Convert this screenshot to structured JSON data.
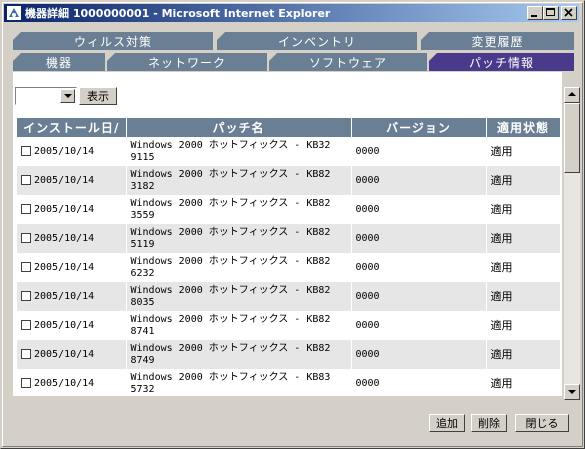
{
  "window": {
    "title": "機器詳細 1000000001 - Microsoft Internet Explorer",
    "icon": "ie-window-icon"
  },
  "tabs_top": [
    {
      "label": "ウィルス対策"
    },
    {
      "label": "インベントリ"
    },
    {
      "label": "変更履歴"
    }
  ],
  "tabs_bottom": [
    {
      "label": "機器"
    },
    {
      "label": "ネットワーク"
    },
    {
      "label": "ソフトウェア"
    },
    {
      "label": "パッチ情報",
      "active": true
    }
  ],
  "filter": {
    "selected": "",
    "show_label": "表示"
  },
  "table": {
    "columns": [
      "インストール日",
      "パッチ名",
      "バージョン",
      "適用状態"
    ],
    "sort_indicator": "/",
    "rows": [
      {
        "date": "2005/10/14",
        "name1": "Windows 2000 ホットフィックス - KB32",
        "name2": "9115",
        "version": "0000",
        "state": "適用"
      },
      {
        "date": "2005/10/14",
        "name1": "Windows 2000 ホットフィックス - KB82",
        "name2": "3182",
        "version": "0000",
        "state": "適用"
      },
      {
        "date": "2005/10/14",
        "name1": "Windows 2000 ホットフィックス - KB82",
        "name2": "3559",
        "version": "0000",
        "state": "適用"
      },
      {
        "date": "2005/10/14",
        "name1": "Windows 2000 ホットフィックス - KB82",
        "name2": "5119",
        "version": "0000",
        "state": "適用"
      },
      {
        "date": "2005/10/14",
        "name1": "Windows 2000 ホットフィックス - KB82",
        "name2": "6232",
        "version": "0000",
        "state": "適用"
      },
      {
        "date": "2005/10/14",
        "name1": "Windows 2000 ホットフィックス - KB82",
        "name2": "8035",
        "version": "0000",
        "state": "適用"
      },
      {
        "date": "2005/10/14",
        "name1": "Windows 2000 ホットフィックス - KB82",
        "name2": "8741",
        "version": "0000",
        "state": "適用"
      },
      {
        "date": "2005/10/14",
        "name1": "Windows 2000 ホットフィックス - KB82",
        "name2": "8749",
        "version": "0000",
        "state": "適用"
      },
      {
        "date": "2005/10/14",
        "name1": "Windows 2000 ホットフィックス - KB83",
        "name2": "5732",
        "version": "0000",
        "state": "適用"
      }
    ]
  },
  "buttons": {
    "add": "追加",
    "delete": "削除",
    "close": "閉じる"
  },
  "colors": {
    "tab": "#6b7f94",
    "tab_active": "#4a3a8c",
    "titlebar": "#0a246a"
  }
}
